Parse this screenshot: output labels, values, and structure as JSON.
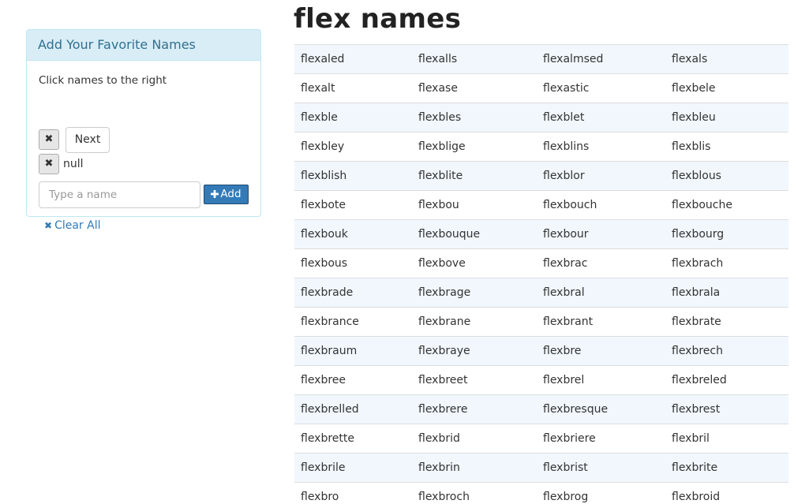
{
  "panel": {
    "heading": "Add Your Favorite Names",
    "hint": "Click names to the right",
    "remove_glyph": "✖",
    "next_label": "Next",
    "favorites": [
      "null"
    ],
    "input_placeholder": "Type a name",
    "add_label": "Add",
    "add_icon": "plus-icon",
    "clear_label": "Clear All",
    "clear_icon": "close-icon"
  },
  "main": {
    "title": "flex names",
    "rows": [
      [
        "flexaled",
        "flexalls",
        "flexalmsed",
        "flexals"
      ],
      [
        "flexalt",
        "flexase",
        "flexastic",
        "flexbele"
      ],
      [
        "flexble",
        "flexbles",
        "flexblet",
        "flexbleu"
      ],
      [
        "flexbley",
        "flexblige",
        "flexblins",
        "flexblis"
      ],
      [
        "flexblish",
        "flexblite",
        "flexblor",
        "flexblous"
      ],
      [
        "flexbote",
        "flexbou",
        "flexbouch",
        "flexbouche"
      ],
      [
        "flexbouk",
        "flexbouque",
        "flexbour",
        "flexbourg"
      ],
      [
        "flexbous",
        "flexbove",
        "flexbrac",
        "flexbrach"
      ],
      [
        "flexbrade",
        "flexbrage",
        "flexbral",
        "flexbrala"
      ],
      [
        "flexbrance",
        "flexbrane",
        "flexbrant",
        "flexbrate"
      ],
      [
        "flexbraum",
        "flexbraye",
        "flexbre",
        "flexbrech"
      ],
      [
        "flexbree",
        "flexbreet",
        "flexbrel",
        "flexbreled"
      ],
      [
        "flexbrelled",
        "flexbrere",
        "flexbresque",
        "flexbrest"
      ],
      [
        "flexbrette",
        "flexbrid",
        "flexbriere",
        "flexbril"
      ],
      [
        "flexbrile",
        "flexbrin",
        "flexbrist",
        "flexbrite"
      ],
      [
        "flexbro",
        "flexbroch",
        "flexbrog",
        "flexbroid"
      ]
    ]
  },
  "colors": {
    "panel_heading_bg": "#d9edf7",
    "panel_border": "#bce8f1",
    "panel_heading_text": "#31708f",
    "primary": "#337ab7",
    "row_stripe": "#f1f7fd"
  }
}
